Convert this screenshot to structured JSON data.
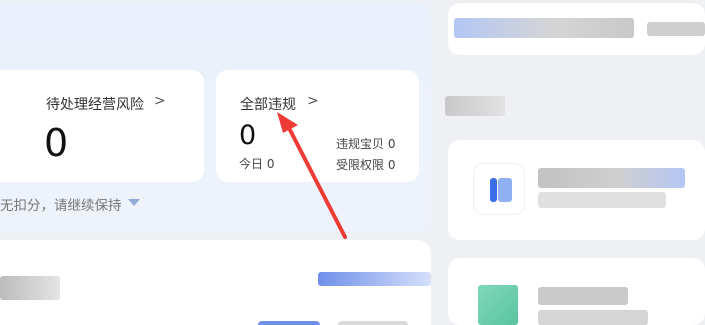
{
  "risk_card": {
    "title": "待处理经营风险",
    "chevron": ">",
    "count": "0"
  },
  "violation_card": {
    "title": "全部违规",
    "chevron": ">",
    "count": "0",
    "today_label": "今日 0",
    "items_label": "违规宝贝 0",
    "restrict_label": "受限权限 0"
  },
  "status_text": "无扣分，请继续保持",
  "colors": {
    "accent_blue": "#93a9d6",
    "arrow_red": "#ef3b35",
    "panel_bg": "#eaf0fb",
    "card_bg": "#ffffff"
  },
  "icons": {
    "dropdown": "triangle-down-icon",
    "pointer": "red-arrow-annotation"
  }
}
